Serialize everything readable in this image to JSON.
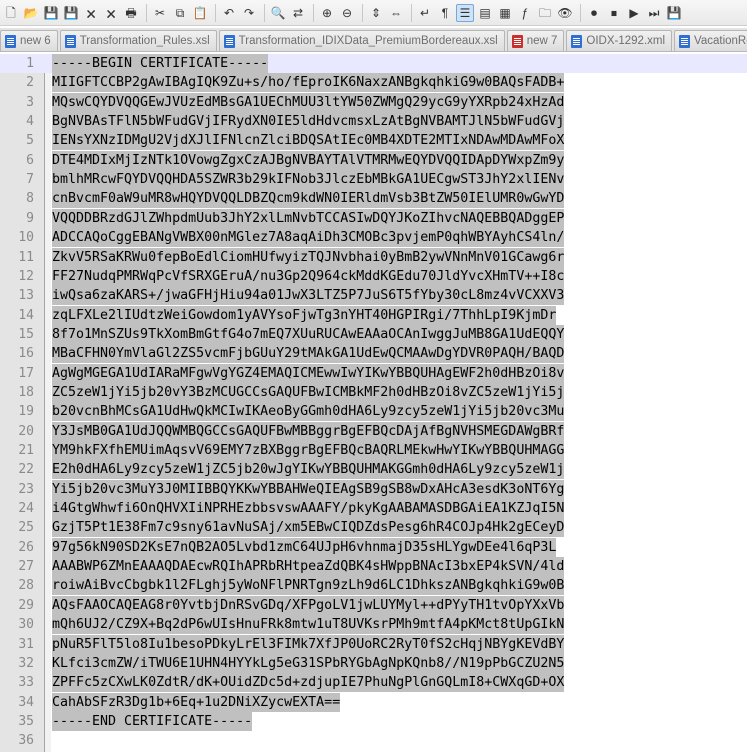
{
  "toolbar": {
    "icons": [
      {
        "name": "new-file-icon",
        "glyph": "🗋"
      },
      {
        "name": "open-file-icon",
        "glyph": "📂"
      },
      {
        "name": "save-icon",
        "glyph": "💾"
      },
      {
        "name": "save-all-icon",
        "glyph": "💾"
      },
      {
        "name": "close-icon",
        "glyph": "🗙"
      },
      {
        "name": "close-all-icon",
        "glyph": "🗙"
      },
      {
        "name": "print-icon",
        "glyph": "🖶"
      },
      {
        "sep": true
      },
      {
        "name": "cut-icon",
        "glyph": "✂"
      },
      {
        "name": "copy-icon",
        "glyph": "⧉"
      },
      {
        "name": "paste-icon",
        "glyph": "📋"
      },
      {
        "sep": true
      },
      {
        "name": "undo-icon",
        "glyph": "↶"
      },
      {
        "name": "redo-icon",
        "glyph": "↷"
      },
      {
        "sep": true
      },
      {
        "name": "find-icon",
        "glyph": "🔍"
      },
      {
        "name": "replace-icon",
        "glyph": "⇄"
      },
      {
        "sep": true
      },
      {
        "name": "zoom-in-icon",
        "glyph": "⊕"
      },
      {
        "name": "zoom-out-icon",
        "glyph": "⊖"
      },
      {
        "sep": true
      },
      {
        "name": "sync-vertical-icon",
        "glyph": "⇕"
      },
      {
        "name": "sync-horizontal-icon",
        "glyph": "⇔"
      },
      {
        "sep": true
      },
      {
        "name": "word-wrap-icon",
        "glyph": "↵"
      },
      {
        "name": "show-all-chars-icon",
        "glyph": "¶"
      },
      {
        "name": "indent-guide-icon",
        "glyph": "☰",
        "active": true
      },
      {
        "name": "define-language-icon",
        "glyph": "▤"
      },
      {
        "name": "doc-map-icon",
        "glyph": "▦"
      },
      {
        "name": "function-list-icon",
        "glyph": "ƒ"
      },
      {
        "name": "folder-workspace-icon",
        "glyph": "🗀"
      },
      {
        "name": "monitoring-icon",
        "glyph": "👁"
      },
      {
        "sep": true
      },
      {
        "name": "record-macro-icon",
        "glyph": "⏺"
      },
      {
        "name": "stop-record-icon",
        "glyph": "⏹"
      },
      {
        "name": "play-macro-icon",
        "glyph": "▶"
      },
      {
        "name": "play-multiple-icon",
        "glyph": "⏭"
      },
      {
        "name": "save-macro-icon",
        "glyph": "💾"
      }
    ]
  },
  "tabs": [
    {
      "label": "new 6",
      "icon": "blue"
    },
    {
      "label": "Transformation_Rules.xsl",
      "icon": "blue"
    },
    {
      "label": "Transformation_IDIXData_PremiumBordereaux.xsl",
      "icon": "blue"
    },
    {
      "label": "new 7",
      "icon": "red"
    },
    {
      "label": "OIDX-1292.xml",
      "icon": "blue"
    },
    {
      "label": "VacationRe",
      "icon": "blue"
    }
  ],
  "editor": {
    "current_line": 1,
    "lines": [
      "-----BEGIN CERTIFICATE-----",
      "MIIGFTCCBP2gAwIBAgIQK9Zu+s/ho/fEproIK6NaxzANBgkqhkiG9w0BAQsFADB+",
      "MQswCQYDVQQGEwJVUzEdMBsGA1UEChMUU3ltYW50ZWMgQ29ycG9yYXRpb24xHzAd",
      "BgNVBAsTFlN5bWFudGVjIFRydXN0IE5ldHdvcmsxLzAtBgNVBAMTJlN5bWFudGVj",
      "IENsYXNzIDMgU2VjdXJlIFNlcnZlciBDQSAtIEc0MB4XDTE2MTIxNDAwMDAwMFoX",
      "DTE4MDIxMjIzNTk1OVowgZgxCzAJBgNVBAYTAlVTMRMwEQYDVQQIDApDYWxpZm9y",
      "bmlhMRcwFQYDVQQHDA5SZWR3b29kIFNob3JlczEbMBkGA1UECgwST3JhY2xlIENv",
      "cnBvcmF0aW9uMR8wHQYDVQQLDBZQcm9kdWN0IERldmVsb3BtZW50IElUMR0wGwYD",
      "VQQDDBRzdGJlZWhpdmUub3JhY2xlLmNvbTCCASIwDQYJKoZIhvcNAQEBBQADggEP",
      "ADCCAQoCggEBANgVWBX00nMGlez7A8aqAiDh3CMOBc3pvjemP0qhWBYAyhCS4ln/",
      "ZkvV5RSaKRWu0fepBoEdlCiomHUfwyizTQJNvbhai0yBmB2ywVNnMnV01GCawg6r",
      "FF27NudqPMRWqPcVfSRXGEruA/nu3Gp2Q964ckMddKGEdu70JldYvcXHmTV++I8c",
      "iwQsa6zaKARS+/jwaGFHjHiu94a01JwX3LTZ5P7JuS6T5fYby30cL8mz4vVCXXV3",
      "zqLFXLe2lIUdtzWeiGowdom1yAVYsoFjwTg3nYHT40HGPIRgi/7ThhLpI9KjmDr",
      "8f7o1MnSZUs9TkXomBmGtfG4o7mEQ7XUuRUCAwEAAaOCAnIwggJuMB8GA1UdEQQY",
      "MBaCFHN0YmVlaGl2ZS5vcmFjbGUuY29tMAkGA1UdEwQCMAAwDgYDVR0PAQH/BAQD",
      "AgWgMGEGA1UdIARaMFgwVgYGZ4EMAQICMEwwIwYIKwYBBQUHAgEWF2h0dHBzOi8v",
      "ZC5zeW1jYi5jb20vY3BzMCUGCCsGAQUFBwICMBkMF2h0dHBzOi8vZC5zeW1jYi5j",
      "b20vcnBhMCsGA1UdHwQkMCIwIKAeoByGGmh0dHA6Ly9zcy5zeW1jYi5jb20vc3Mu",
      "Y3JsMB0GA1UdJQQWMBQGCCsGAQUFBwMBBggrBgEFBQcDAjAfBgNVHSMEGDAWgBRf",
      "YM9hkFXfhEMUimAqsvV69EMY7zBXBggrBgEFBQcBAQRLMEkwHwYIKwYBBQUHMAGG",
      "E2h0dHA6Ly9zcy5zeW1jZC5jb20wJgYIKwYBBQUHMAKGGmh0dHA6Ly9zcy5zeW1j",
      "Yi5jb20vc3MuY3J0MIIBBQYKKwYBBAHWeQIEAgSB9gSB8wDxAHcA3esdK3oNT6Yg",
      "i4GtgWhwfi6OnQHVXIiNPRHEzbbsvswAAAFY/pkyKgAABAMASDBGAiEA1KZJqI5N",
      "GzjT5Pt1E38Fm7c9sny61avNuSAj/xm5EBwCIQDZdsPesg6hR4COJp4Hk2gECeyD",
      "97g56kN90SD2KsE7nQB2AO5Lvbd1zmC64UJpH6vhnmajD35sHLYgwDEe4l6qP3L",
      "AAABWP6ZMnEAAAQDAEcwRQIhAPRbRHtpeaZdQBK4sHWppBNAcI3bxEP4kSVN/4ld",
      "roiwAiBvcCbgbk1l2FLghj5yWoNFlPNRTgn9zLh9d6LC1DhkszANBgkqhkiG9w0B",
      "AQsFAAOCAQEAG8r0YvtbjDnRSvGDq/XFPgoLV1jwLUYMyl++dPYyTH1tvOpYXxVb",
      "mQh6UJ2/CZ9X+Bq2dP6wUIsHnuFRk8mtw1uT8UVKsrPMh9mtfA4pKMct8tUpGIkN",
      "pNuR5FlT5lo8Iu1besoPDkyLrEl3FIMk7XfJP0UoRC2RyT0fS2cHqjNBYgKEVdBY",
      "KLfci3cmZW/iTWU6E1UHN4HYYkLg5eG31SPbRYGbAgNpKQnb8//N19pPbGCZU2N5",
      "ZPFFc5zCXwLK0ZdtR/dK+OUidZDc5d+zdjupIE7PhuNgPlGnGQLmI8+CWXqGD+OX",
      "CahAbSFzR3Dg1b+6Eq+1u2DNiXZycwEXTA==",
      "-----END CERTIFICATE-----",
      ""
    ]
  }
}
